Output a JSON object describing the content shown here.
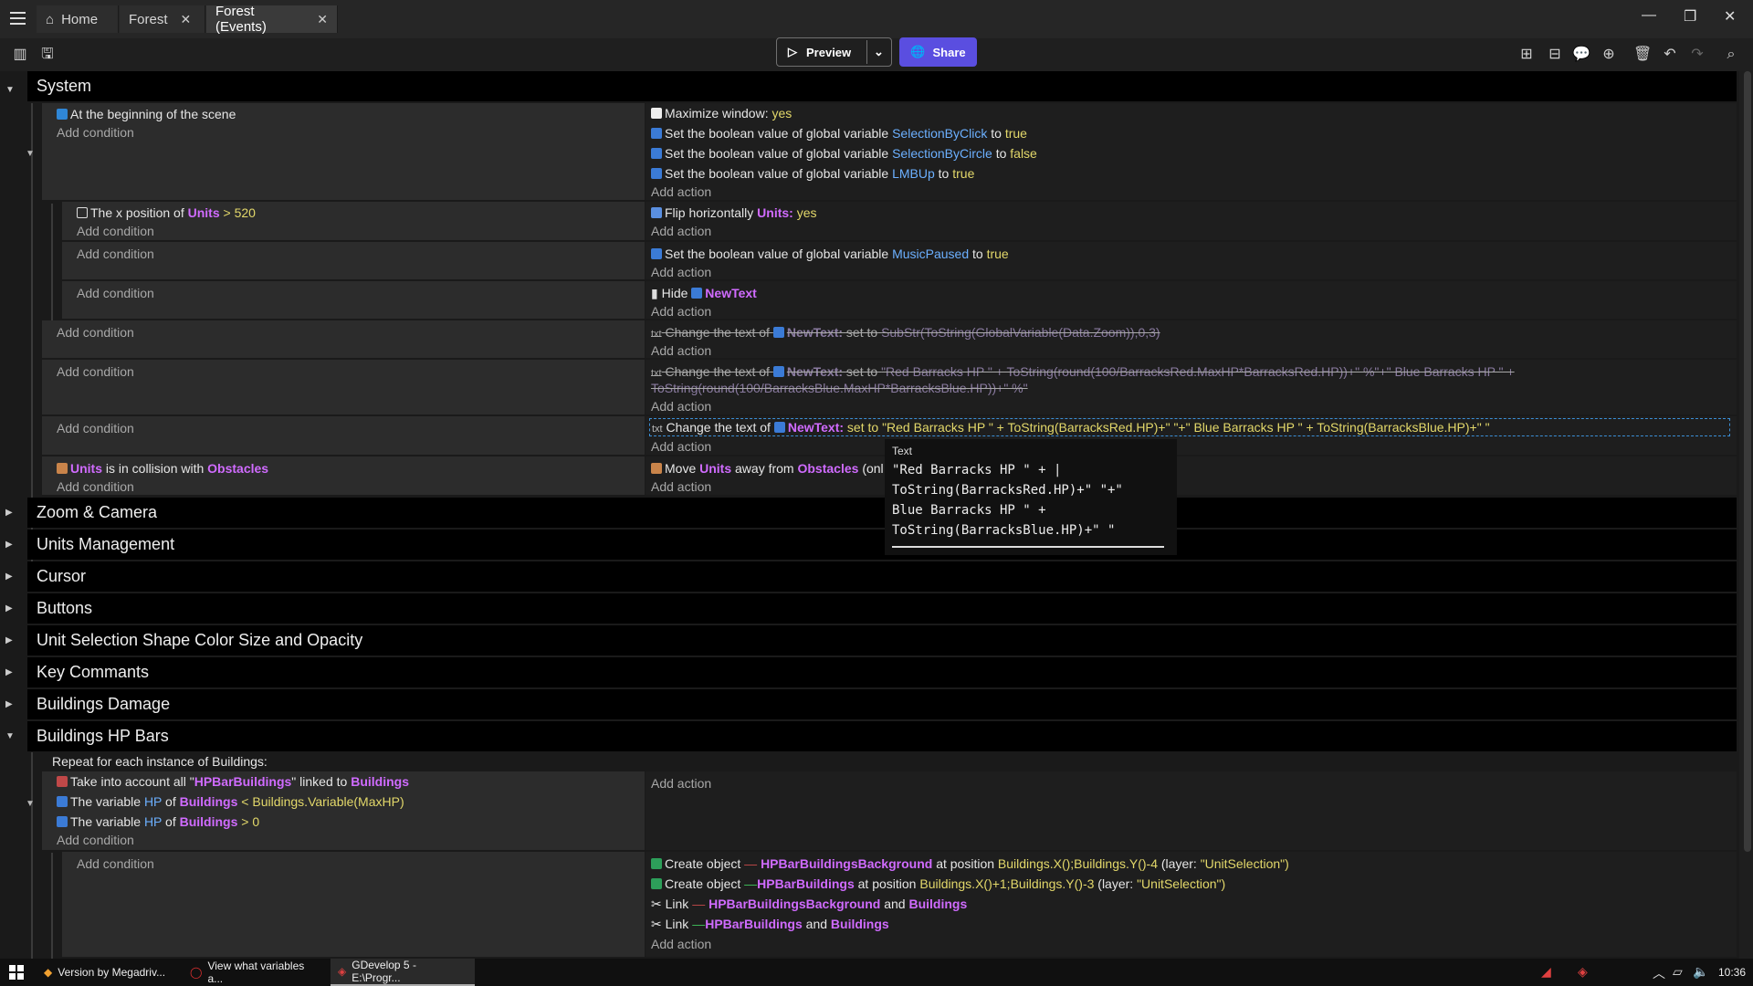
{
  "tabs": [
    {
      "label": "Home",
      "icon": "home-icon"
    },
    {
      "label": "Forest"
    },
    {
      "label": "Forest (Events)"
    }
  ],
  "toolbar": {
    "preview_label": "Preview",
    "share_label": "Share"
  },
  "groups": {
    "system": "System",
    "zoom": "Zoom & Camera",
    "units": "Units Management",
    "cursor": "Cursor",
    "buttons": "Buttons",
    "selection": "Unit Selection Shape Color Size and Opacity",
    "keys": "Key Commants",
    "damage": "Buildings Damage",
    "hpbars": "Buildings HP Bars"
  },
  "common": {
    "add_condition": "Add condition",
    "add_action": "Add action"
  },
  "events": {
    "e1": {
      "condition": "At the beginning of the scene",
      "a1_text": "Maximize window:",
      "a1_val": "yes",
      "a2_text": "Set the boolean value of global variable",
      "a2_var": "SelectionByClick",
      "a2_to": "to",
      "a2_val": "true",
      "a3_text": "Set the boolean value of global variable",
      "a3_var": "SelectionByCircle",
      "a3_to": "to",
      "a3_val": "false",
      "a4_text": "Set the boolean value of global variable",
      "a4_var": "LMBUp",
      "a4_to": "to",
      "a4_val": "true"
    },
    "e2": {
      "c_pre": "The x position of",
      "c_obj": "Units",
      "c_op": ">",
      "c_val": "520",
      "a_text": "Flip horizontally",
      "a_obj": "Units:",
      "a_val": "yes"
    },
    "e3": {
      "a_text": "Set the boolean value of global variable",
      "a_var": "MusicPaused",
      "a_to": "to",
      "a_val": "true"
    },
    "e4": {
      "a_text": "Hide",
      "a_obj": "NewText"
    },
    "e5": {
      "a_text": "Change the text of",
      "a_obj": "NewText:",
      "a_set": "set to",
      "a_val": "SubStr(ToString(GlobalVariable(Data.Zoom)),0,3)"
    },
    "e6": {
      "a_text": "Change the text of",
      "a_obj": "NewText:",
      "a_set": "set to",
      "a_val1": "\"Red Barracks HP \" + ToString(round(100/BarracksRed.MaxHP*BarracksRed.HP))+\" %\"+\" Blue Barracks HP \" +",
      "a_val2": "ToString(round(100/BarracksBlue.MaxHP*BarracksBlue.HP))+\" %\""
    },
    "e7": {
      "a_text": "Change the text of",
      "a_obj": "NewText:",
      "a_set": "set to",
      "a_val": "\"Red Barracks HP \" + ToString(BarracksRed.HP)+\" \"+\" Blue Barracks HP \" + ToString(BarracksBlue.HP)+\" \""
    },
    "e8": {
      "c_obj": "Units",
      "c_mid": "is in collision with",
      "c_obj2": "Obstacles",
      "a_text": "Move",
      "a_obj": "Units",
      "a_mid": "away from",
      "a_obj2": "Obstacles",
      "a_tail": "(onl"
    },
    "hp": {
      "repeat": "Repeat for each instance of Buildings:",
      "c1_text": "Take into account all \"",
      "c1_obj": "HPBarBuildings",
      "c1_mid": "\" linked to",
      "c1_obj2": "Buildings",
      "c2_text": "The variable",
      "c2_var": "HP",
      "c2_of": "of",
      "c2_obj": "Buildings",
      "c2_op": "<",
      "c2_val": "Buildings.Variable(MaxHP)",
      "c3_text": "The variable",
      "c3_var": "HP",
      "c3_of": "of",
      "c3_obj": "Buildings",
      "c3_op": ">",
      "c3_val": "0",
      "s_a1_text": "Create object",
      "s_a1_obj": "HPBarBuildingsBackground",
      "s_a1_mid": "at position",
      "s_a1_val": "Buildings.X();Buildings.Y()-4",
      "s_a1_layer": "(layer:",
      "s_a1_lval": "\"UnitSelection\")",
      "s_a2_text": "Create object",
      "s_a2_obj": "HPBarBuildings",
      "s_a2_mid": "at position",
      "s_a2_val": "Buildings.X()+1;Buildings.Y()-3",
      "s_a2_layer": "(layer:",
      "s_a2_lval": "\"UnitSelection\")",
      "s_a3_text": "Link",
      "s_a3_obj": "HPBarBuildingsBackground",
      "s_a3_and": "and",
      "s_a3_obj2": "Buildings",
      "s_a4_text": "Link",
      "s_a4_obj": "HPBarBuildings",
      "s_a4_and": "and",
      "s_a4_obj2": "Buildings"
    }
  },
  "tooltip": {
    "label": "Text",
    "value": "\"Red Barracks HP \" + |\nToString(BarracksRed.HP)+\" \"+\"\nBlue Barracks HP \" +\nToString(BarracksBlue.HP)+\" \""
  },
  "taskbar": {
    "items": [
      {
        "label": "Version by Megadriv..."
      },
      {
        "label": "View what variables a..."
      },
      {
        "label": "GDevelop 5 - E:\\Progr..."
      }
    ],
    "clock": "10:36"
  },
  "colors": {
    "share": "#5a4ee0",
    "object": "#d06bff",
    "variable": "#6cb0ff",
    "value": "#e3d86a"
  }
}
